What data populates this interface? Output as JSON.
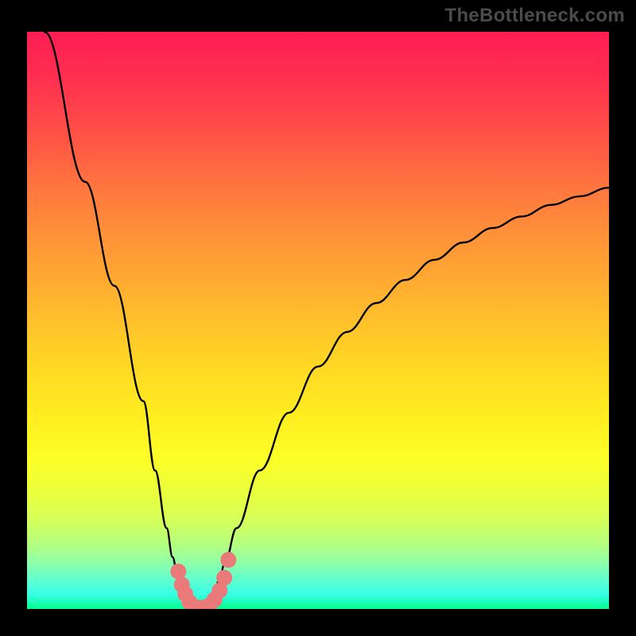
{
  "watermark": "TheBottleneck.com",
  "chart_data": {
    "type": "line",
    "title": "",
    "xlabel": "",
    "ylabel": "",
    "xlim": [
      0,
      100
    ],
    "ylim": [
      0,
      100
    ],
    "series": [
      {
        "name": "bottleneck-curve",
        "x": [
          3,
          10,
          15,
          20,
          22,
          24,
          25,
          26,
          27,
          28,
          29,
          30,
          31,
          32,
          33,
          34,
          36,
          40,
          45,
          50,
          55,
          60,
          65,
          70,
          75,
          80,
          85,
          90,
          95,
          100
        ],
        "y": [
          100,
          74,
          56,
          36,
          24,
          14,
          9,
          5,
          2,
          0.5,
          0,
          0,
          0.5,
          2,
          5,
          8,
          14,
          24,
          34,
          42,
          48,
          53,
          57,
          60.5,
          63.5,
          66,
          68,
          70,
          71.5,
          73
        ]
      }
    ],
    "markers": {
      "name": "highlighted-points",
      "color": "#ea7a7a",
      "points": [
        {
          "x": 26.0,
          "y": 6.5
        },
        {
          "x": 26.6,
          "y": 4.2
        },
        {
          "x": 27.2,
          "y": 2.6
        },
        {
          "x": 27.9,
          "y": 1.2
        },
        {
          "x": 28.7,
          "y": 0.4
        },
        {
          "x": 30.0,
          "y": 0.2
        },
        {
          "x": 31.3,
          "y": 0.6
        },
        {
          "x": 32.2,
          "y": 1.6
        },
        {
          "x": 33.1,
          "y": 3.2
        },
        {
          "x": 33.9,
          "y": 5.4
        },
        {
          "x": 34.6,
          "y": 8.5
        }
      ]
    },
    "gradient_stops": [
      {
        "pos": 0,
        "color": "#ff1d53"
      },
      {
        "pos": 50,
        "color": "#ffe020"
      },
      {
        "pos": 100,
        "color": "#00ff8e"
      }
    ]
  }
}
